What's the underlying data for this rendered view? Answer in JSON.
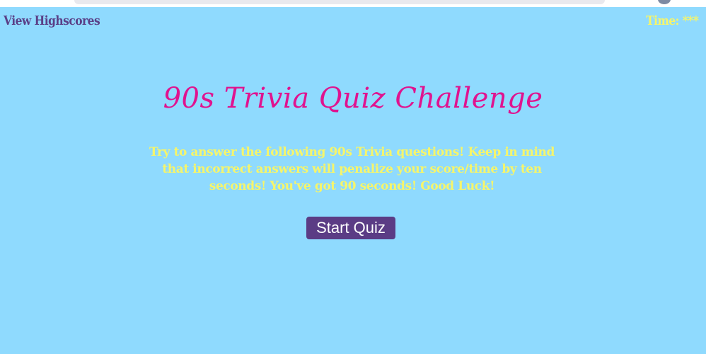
{
  "header": {
    "highscores_link": "View Highscores",
    "timer_label": "Time:",
    "timer_value": "***"
  },
  "main": {
    "title": "90s Trivia Quiz Challenge",
    "intro": "Try to answer the following 90s Trivia questions! Keep in mind that incorrect answers will penalize your score/time by ten seconds! You've got 90 seconds! Good Luck!",
    "start_button": "Start Quiz"
  },
  "colors": {
    "background": "#8fdafe",
    "title": "#e0138f",
    "accent_text": "#f6f56a",
    "link": "#5a3f87",
    "button": "#5b3c85"
  }
}
